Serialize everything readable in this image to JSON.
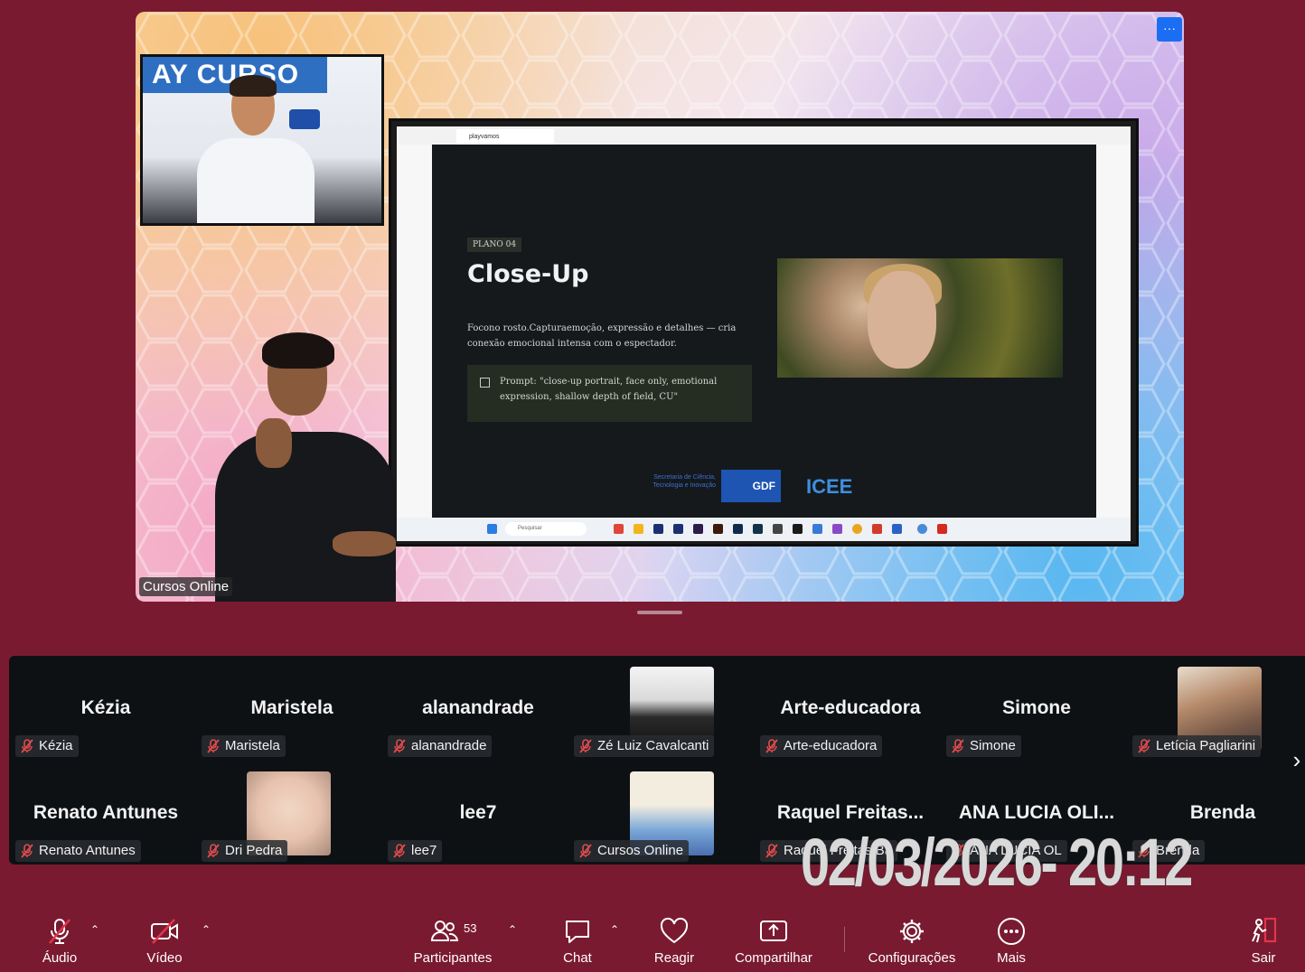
{
  "shared_screen": {
    "owner_label": "Cursos Online",
    "more_button": "···",
    "presenter_banner": "AY CURSO",
    "presenter_logo": "GDF",
    "browser_tab": "playvamos",
    "slide": {
      "tag": "PLANO 04",
      "title": "Close-Up",
      "description": "Focono rosto.Capturaemoção, expressão e detalhes — cria conexão emocional intensa com o espectador.",
      "prompt": "Prompt: \"close-up portrait, face only, emotional expression, shallow depth of field, CU\"",
      "logo_secretaria": "Secretaria de Ciência, Tecnologia e Inovação",
      "logo_gdf": "GDF",
      "logo_icee": "ICEE"
    },
    "taskbar_search": "Pesquisar"
  },
  "gallery": {
    "tiles": [
      {
        "big": "Kézia",
        "label": "Kézia"
      },
      {
        "big": "Maristela",
        "label": "Maristela"
      },
      {
        "big": "alanandrade",
        "label": "alanandrade"
      },
      {
        "big": "",
        "label": "Zé Luiz Cavalcanti"
      },
      {
        "big": "Arte-educadora",
        "label": "Arte-educadora"
      },
      {
        "big": "Simone",
        "label": "Simone"
      },
      {
        "big": "",
        "label": "Letícia Pagliarini"
      },
      {
        "big": "Renato Antunes",
        "label": "Renato Antunes"
      },
      {
        "big": "",
        "label": "Dri Pedra"
      },
      {
        "big": "lee7",
        "label": "lee7"
      },
      {
        "big": "",
        "label": "Cursos Online"
      },
      {
        "big": "Raquel  Freitas...",
        "label": "Raquel Freitas Ba"
      },
      {
        "big": "ANA LUCIA OLI...",
        "label": "ANA LUCIA OL"
      },
      {
        "big": "Brenda",
        "label": "Brenda"
      }
    ]
  },
  "datestamp": "02/03/2026- 20:12",
  "toolbar": {
    "audio": "Áudio",
    "video": "Vídeo",
    "participants": "Participantes",
    "participants_count": "53",
    "chat": "Chat",
    "react": "Reagir",
    "share": "Compartilhar",
    "settings": "Configurações",
    "more": "Mais",
    "leave": "Sair"
  }
}
